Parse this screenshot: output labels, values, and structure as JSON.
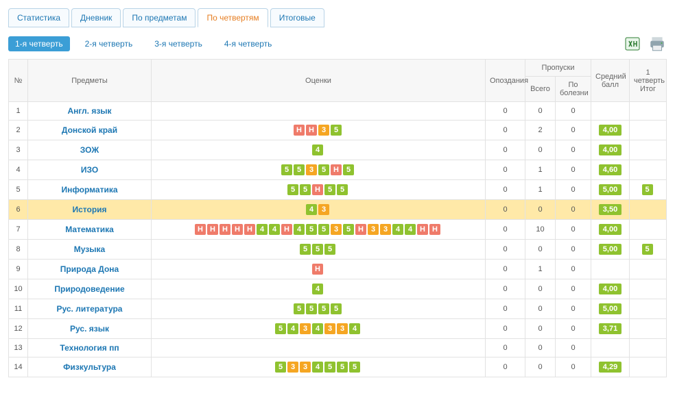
{
  "tabs": [
    "Статистика",
    "Дневник",
    "По предметам",
    "По четвертям",
    "Итоговые"
  ],
  "active_tab": 3,
  "subtabs": [
    "1-я четверть",
    "2-я четверть",
    "3-я четверть",
    "4-я четверть"
  ],
  "active_subtab": 0,
  "icons": {
    "excel": "excel-icon",
    "print": "print-icon"
  },
  "headers": {
    "num": "№",
    "subject": "Предметы",
    "marks": "Оценки",
    "late": "Опоздания",
    "absences": "Пропуски",
    "abs_total": "Всего",
    "abs_ill": "По болезни",
    "avg": "Средний балл",
    "final": "1 четверть Итог"
  },
  "rows": [
    {
      "n": 1,
      "subject": "Англ. язык",
      "marks": [],
      "late": 0,
      "abs_total": 0,
      "abs_ill": 0,
      "avg": "",
      "final": ""
    },
    {
      "n": 2,
      "subject": "Донской край",
      "marks": [
        "Н",
        "Н",
        "3",
        "5"
      ],
      "late": 0,
      "abs_total": 2,
      "abs_ill": 0,
      "avg": "4,00",
      "final": ""
    },
    {
      "n": 3,
      "subject": "ЗОЖ",
      "marks": [
        "4"
      ],
      "late": 0,
      "abs_total": 0,
      "abs_ill": 0,
      "avg": "4,00",
      "final": ""
    },
    {
      "n": 4,
      "subject": "ИЗО",
      "marks": [
        "5",
        "5",
        "3",
        "5",
        "Н",
        "5"
      ],
      "late": 0,
      "abs_total": 1,
      "abs_ill": 0,
      "avg": "4,60",
      "final": ""
    },
    {
      "n": 5,
      "subject": "Информатика",
      "marks": [
        "5",
        "5",
        "Н",
        "5",
        "5"
      ],
      "late": 0,
      "abs_total": 1,
      "abs_ill": 0,
      "avg": "5,00",
      "final": "5"
    },
    {
      "n": 6,
      "subject": "История",
      "marks": [
        "4",
        "3"
      ],
      "late": 0,
      "abs_total": 0,
      "abs_ill": 0,
      "avg": "3,50",
      "final": "",
      "highlight": true
    },
    {
      "n": 7,
      "subject": "Математика",
      "marks": [
        "Н",
        "Н",
        "Н",
        "Н",
        "Н",
        "4",
        "4",
        "Н",
        "4",
        "5",
        "5",
        "3",
        "5",
        "Н",
        "3",
        "3",
        "4",
        "4",
        "Н",
        "Н"
      ],
      "late": 0,
      "abs_total": 10,
      "abs_ill": 0,
      "avg": "4,00",
      "final": ""
    },
    {
      "n": 8,
      "subject": "Музыка",
      "marks": [
        "5",
        "5",
        "5"
      ],
      "late": 0,
      "abs_total": 0,
      "abs_ill": 0,
      "avg": "5,00",
      "final": "5"
    },
    {
      "n": 9,
      "subject": "Природа Дона",
      "marks": [
        "Н"
      ],
      "late": 0,
      "abs_total": 1,
      "abs_ill": 0,
      "avg": "",
      "final": ""
    },
    {
      "n": 10,
      "subject": "Природоведение",
      "marks": [
        "4"
      ],
      "late": 0,
      "abs_total": 0,
      "abs_ill": 0,
      "avg": "4,00",
      "final": ""
    },
    {
      "n": 11,
      "subject": "Рус. литература",
      "marks": [
        "5",
        "5",
        "5",
        "5"
      ],
      "late": 0,
      "abs_total": 0,
      "abs_ill": 0,
      "avg": "5,00",
      "final": ""
    },
    {
      "n": 12,
      "subject": "Рус. язык",
      "marks": [
        "5",
        "4",
        "3",
        "4",
        "3",
        "3",
        "4"
      ],
      "late": 0,
      "abs_total": 0,
      "abs_ill": 0,
      "avg": "3,71",
      "final": ""
    },
    {
      "n": 13,
      "subject": "Технология пп",
      "marks": [],
      "late": 0,
      "abs_total": 0,
      "abs_ill": 0,
      "avg": "",
      "final": ""
    },
    {
      "n": 14,
      "subject": "Физкультура",
      "marks": [
        "5",
        "3",
        "3",
        "4",
        "5",
        "5",
        "5"
      ],
      "late": 0,
      "abs_total": 0,
      "abs_ill": 0,
      "avg": "4,29",
      "final": ""
    }
  ]
}
